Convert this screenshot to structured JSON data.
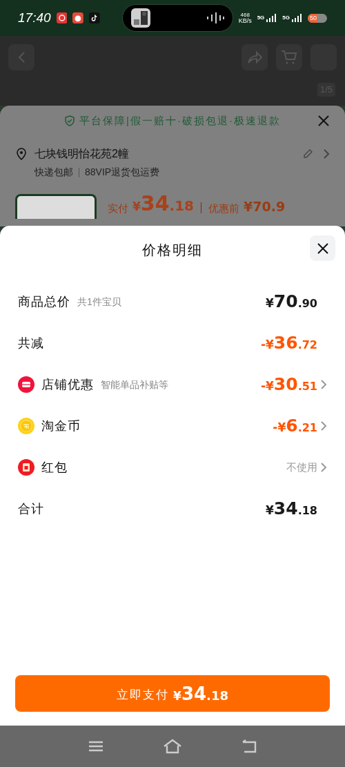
{
  "status_bar": {
    "time": "17:40",
    "speed": "468",
    "speed_unit": "KB/s",
    "networks": [
      "5G",
      "5G"
    ],
    "battery": "50"
  },
  "background": {
    "counter": "1/5",
    "guarantee": "平台保障|假一赔十·破损包退·极速退款",
    "address": "七块钱明怡花苑2幢",
    "shipping": "快递包邮",
    "shipping_note": "88VIP退货包运费",
    "paid_label": "实付",
    "paid": {
      "symbol": "¥",
      "integer": "34",
      "decimal": ".18"
    },
    "before_label": "优惠前",
    "before": "¥70.9"
  },
  "sheet": {
    "title": "价格明细",
    "rows": [
      {
        "kind": "plain",
        "label": "商品总价",
        "note": "共1件宝贝",
        "amount": {
          "symbol": "¥",
          "integer": "70",
          "decimal": ".90"
        },
        "color": "#1a1a1a",
        "arrow": false
      },
      {
        "kind": "plain",
        "label": "共减",
        "amount": {
          "symbol": "-¥",
          "integer": "36",
          "decimal": ".72"
        },
        "color": "#ff5500",
        "arrow": false
      },
      {
        "kind": "shop",
        "label": "店铺优惠",
        "note": "智能单品补贴等",
        "amount": {
          "symbol": "-¥",
          "integer": "30",
          "decimal": ".51"
        },
        "color": "#ff5500",
        "arrow": true
      },
      {
        "kind": "coin",
        "label": "淘金币",
        "amount": {
          "symbol": "-¥",
          "integer": "6",
          "decimal": ".21"
        },
        "color": "#ff5500",
        "arrow": true
      },
      {
        "kind": "redpacket",
        "label": "红包",
        "value": "不使用",
        "arrow": true
      },
      {
        "kind": "plain",
        "label": "合计",
        "amount": {
          "symbol": "¥",
          "integer": "34",
          "decimal": ".18"
        },
        "color": "#1a1a1a",
        "arrow": false
      }
    ],
    "pay_button": {
      "label": "立即支付",
      "amount": {
        "symbol": "¥",
        "integer": "34",
        "decimal": ".18"
      }
    }
  }
}
